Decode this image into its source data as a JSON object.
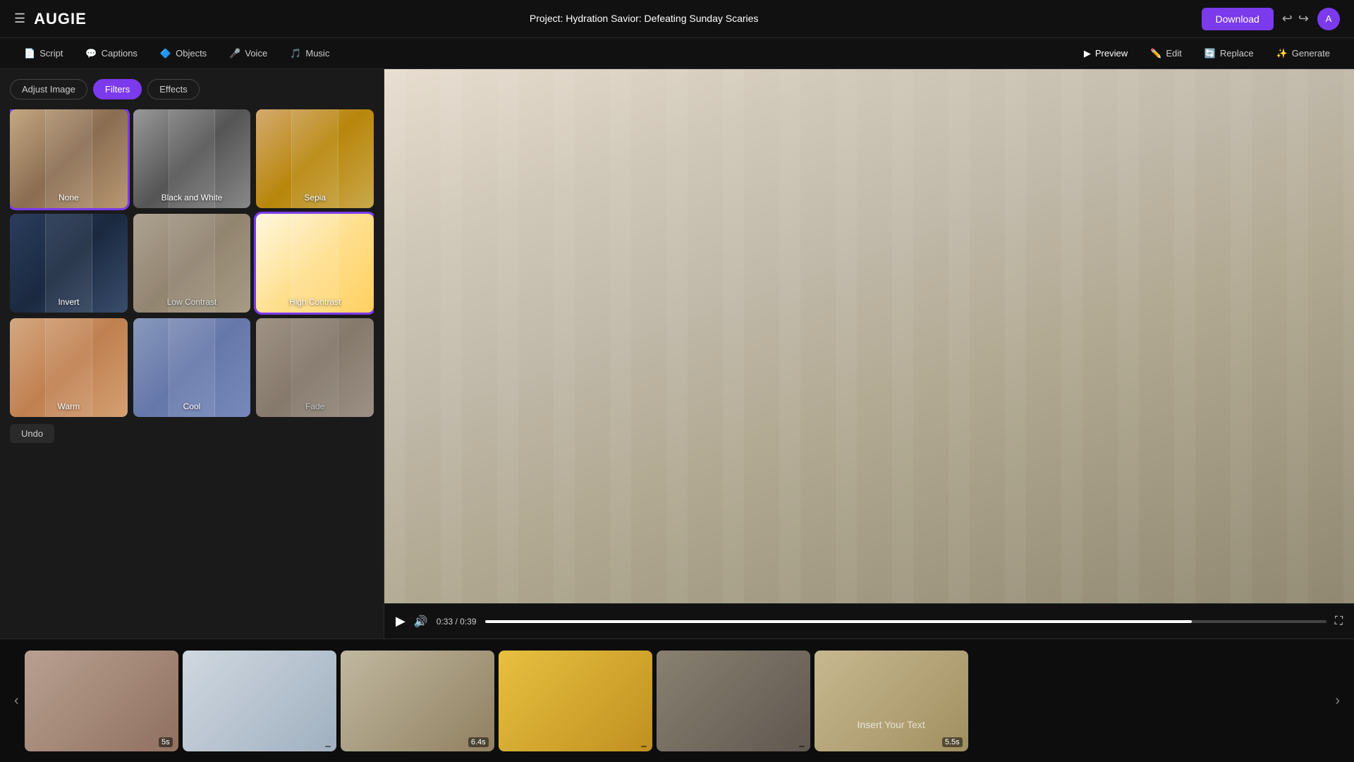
{
  "topbar": {
    "logo": "AUGIE",
    "project_label": "Project:",
    "project_name": "Hydration Savior: Defeating Sunday Scaries",
    "download_label": "Download"
  },
  "navbar": {
    "items": [
      {
        "id": "script",
        "label": "Script",
        "icon": "📄"
      },
      {
        "id": "captions",
        "label": "Captions",
        "icon": "💬"
      },
      {
        "id": "objects",
        "label": "Objects",
        "icon": "🔷"
      },
      {
        "id": "voice",
        "label": "Voice",
        "icon": "🎤"
      },
      {
        "id": "music",
        "label": "Music",
        "icon": "🎵"
      }
    ],
    "right_items": [
      {
        "id": "preview",
        "label": "Preview",
        "icon": "▶"
      },
      {
        "id": "edit",
        "label": "Edit",
        "icon": "✏️"
      },
      {
        "id": "replace",
        "label": "Replace",
        "icon": "🔄"
      },
      {
        "id": "generate",
        "label": "Generate",
        "icon": "✨"
      }
    ]
  },
  "left_panel": {
    "tabs": [
      {
        "id": "adjust",
        "label": "Adjust Image",
        "active": false
      },
      {
        "id": "filters",
        "label": "Filters",
        "active": true
      },
      {
        "id": "effects",
        "label": "Effects",
        "active": false
      }
    ],
    "filters": [
      {
        "id": "none",
        "label": "None",
        "selected": true
      },
      {
        "id": "bw",
        "label": "Black and White",
        "selected": false
      },
      {
        "id": "sepia",
        "label": "Sepia",
        "selected": false
      },
      {
        "id": "invert",
        "label": "Invert",
        "selected": false
      },
      {
        "id": "low_contrast",
        "label": "Low Contrast",
        "selected": false
      },
      {
        "id": "high_contrast",
        "label": "High Contrast",
        "selected": false
      },
      {
        "id": "warm",
        "label": "Warm",
        "selected": false
      },
      {
        "id": "cool",
        "label": "Cool",
        "selected": false
      },
      {
        "id": "fade",
        "label": "Fade",
        "selected": false
      }
    ],
    "undo_label": "Undo"
  },
  "video": {
    "time_current": "0:33",
    "time_total": "0:39",
    "progress_percent": 84
  },
  "timeline": {
    "clips": [
      {
        "id": 1,
        "duration": "5s"
      },
      {
        "id": 2,
        "duration": ""
      },
      {
        "id": 3,
        "duration": "6.4s"
      },
      {
        "id": 4,
        "duration": ""
      },
      {
        "id": 5,
        "duration": ""
      },
      {
        "id": 6,
        "duration": "5.5s",
        "insert_text": "Insert Your Text"
      }
    ]
  }
}
